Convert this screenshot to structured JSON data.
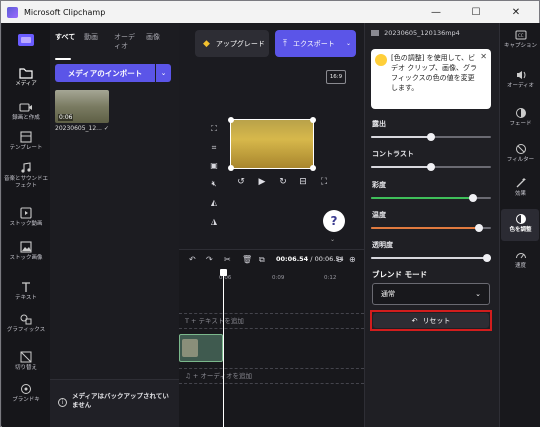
{
  "window": {
    "title": "Microsoft Clipchamp",
    "minimize": "—",
    "maximize": "☐",
    "close": "✕"
  },
  "leftnav": {
    "items": [
      {
        "label": "メディア",
        "icon": "folder-icon"
      },
      {
        "label": "録画と作成",
        "icon": "camera-icon"
      },
      {
        "label": "テンプレート",
        "icon": "template-icon"
      },
      {
        "label": "音楽とサウンドエフェクト",
        "icon": "music-icon"
      },
      {
        "label": "ストック動画",
        "icon": "film-icon"
      },
      {
        "label": "ストック画像",
        "icon": "image-icon"
      },
      {
        "label": "テキスト",
        "icon": "text-icon"
      },
      {
        "label": "グラフィックス",
        "icon": "shapes-icon"
      },
      {
        "label": "切り替え",
        "icon": "transition-icon"
      },
      {
        "label": "ブランドキ",
        "icon": "brand-icon"
      }
    ]
  },
  "media": {
    "tabs": [
      "すべて",
      "動画",
      "オーディオ",
      "画像"
    ],
    "import_label": "メディアのインポート",
    "thumb_duration": "0:06",
    "thumb_caption": "20230605_12...",
    "backup_text": "メディアはバックアップされていません"
  },
  "preview": {
    "upgrade_label": "アップグレード",
    "export_label": "エクスポート",
    "ratio": "16:9",
    "help": "?"
  },
  "timeline": {
    "current": "00:06.54",
    "total": "00:06.54",
    "ticks": [
      "0:06",
      "0:09",
      "0:12"
    ],
    "text_track": "T  +  テキストを追加",
    "audio_track": "♫  +  オーディオを追加"
  },
  "properties": {
    "file_name": "20230605_120136mp4",
    "tip_text": "[色の調整] を使用して、ビデオ クリップ、画像、グラフィックスの色の値を変更します。",
    "sliders": [
      {
        "label": "露出",
        "value": 0.5,
        "color": "#d8d8de"
      },
      {
        "label": "コントラスト",
        "value": 0.5,
        "color": "#d8d8de"
      },
      {
        "label": "彩度",
        "value": 0.85,
        "color": "#3fbf5a"
      },
      {
        "label": "温度",
        "value": 0.9,
        "color": "#e07a3f"
      },
      {
        "label": "透明度",
        "value": 1.0,
        "color": "#d8d8de"
      }
    ],
    "blend_label": "ブレンド モード",
    "blend_value": "通常",
    "reset_label": "リセット"
  },
  "rightnav": {
    "items": [
      {
        "label": "キャプション",
        "icon": "captions-icon"
      },
      {
        "label": "オーディオ",
        "icon": "speaker-icon"
      },
      {
        "label": "フェード",
        "icon": "fade-icon"
      },
      {
        "label": "フィルター",
        "icon": "filter-icon"
      },
      {
        "label": "効果",
        "icon": "magic-wand-icon"
      },
      {
        "label": "色を調整",
        "icon": "color-adjust-icon",
        "active": true
      },
      {
        "label": "速度",
        "icon": "speed-icon"
      }
    ]
  },
  "colors": {
    "accent": "#5b55e8",
    "highlight": "#d21d1d"
  }
}
